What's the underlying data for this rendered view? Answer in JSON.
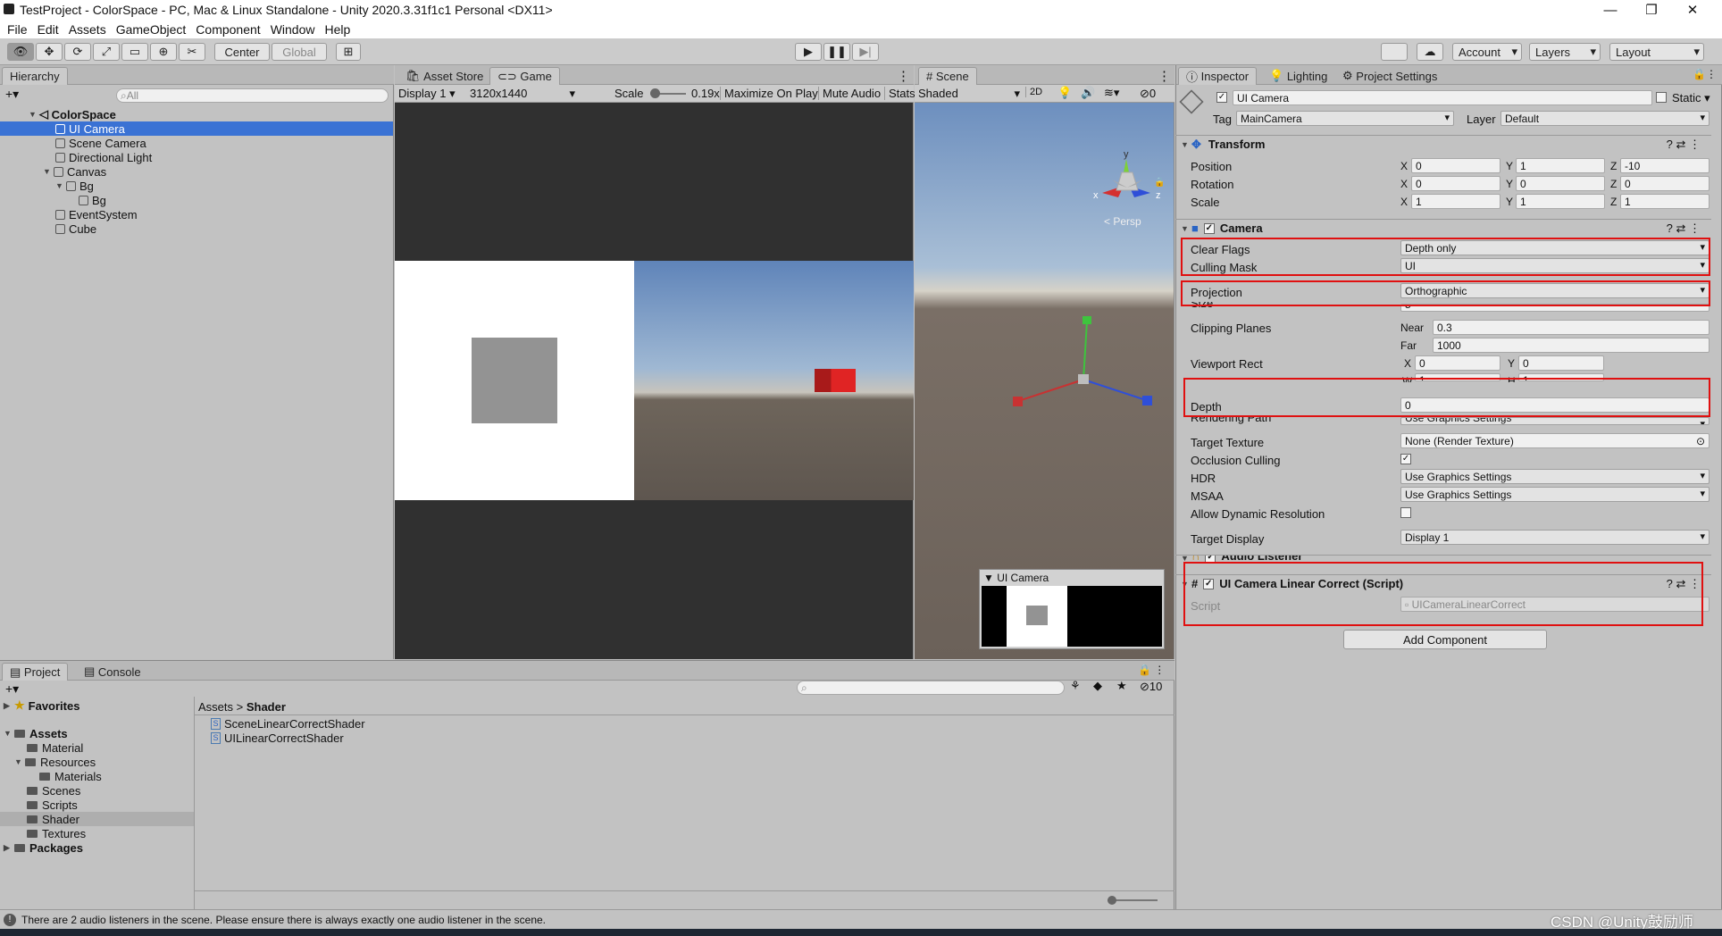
{
  "window": {
    "title": "TestProject - ColorSpace - PC, Mac & Linux Standalone - Unity 2020.3.31f1c1 Personal <DX11>"
  },
  "menu": [
    "File",
    "Edit",
    "Assets",
    "GameObject",
    "Component",
    "Window",
    "Help"
  ],
  "toolbar": {
    "center": "Center",
    "global": "Global",
    "account": "Account",
    "layers": "Layers",
    "layout": "Layout"
  },
  "hierarchy": {
    "tab": "Hierarchy",
    "search_placeholder": "All",
    "items": [
      {
        "label": "ColorSpace"
      },
      {
        "label": "UI Camera"
      },
      {
        "label": "Scene Camera"
      },
      {
        "label": "Directional Light"
      },
      {
        "label": "Canvas"
      },
      {
        "label": "Bg"
      },
      {
        "label": "Bg"
      },
      {
        "label": "EventSystem"
      },
      {
        "label": "Cube"
      }
    ]
  },
  "game": {
    "tabs": [
      "Asset Store",
      "Game"
    ],
    "display": "Display 1",
    "resolution": "3120x1440",
    "scale_label": "Scale",
    "scale_value": "0.19x",
    "maximize": "Maximize On Play",
    "mute": "Mute Audio",
    "stats": "Stats"
  },
  "scene": {
    "tab": "Scene",
    "shading": "Shaded",
    "mode_2d": "2D",
    "gizmo_count": "0",
    "persp": "< Persp",
    "preview_title": "UI Camera",
    "axis_y": "y",
    "axis_x": "x",
    "axis_z": "z"
  },
  "inspector": {
    "tabs": [
      "Inspector",
      "Lighting",
      "Project Settings"
    ],
    "object_name": "UI Camera",
    "static_label": "Static",
    "tag_label": "Tag",
    "tag_value": "MainCamera",
    "layer_label": "Layer",
    "layer_value": "Default",
    "transform": {
      "title": "Transform",
      "position": {
        "label": "Position",
        "x": "0",
        "y": "1",
        "z": "-10"
      },
      "rotation": {
        "label": "Rotation",
        "x": "0",
        "y": "0",
        "z": "0"
      },
      "scale": {
        "label": "Scale",
        "x": "1",
        "y": "1",
        "z": "1"
      }
    },
    "camera": {
      "title": "Camera",
      "clear_flags": {
        "label": "Clear Flags",
        "value": "Depth only"
      },
      "culling_mask": {
        "label": "Culling Mask",
        "value": "UI"
      },
      "projection": {
        "label": "Projection",
        "value": "Orthographic"
      },
      "size": {
        "label": "Size",
        "value": "5"
      },
      "clipping": {
        "label": "Clipping Planes",
        "near_label": "Near",
        "near": "0.3",
        "far_label": "Far",
        "far": "1000"
      },
      "viewport": {
        "label": "Viewport Rect",
        "x": "0",
        "y": "0",
        "w": "1",
        "h": "1"
      },
      "depth": {
        "label": "Depth",
        "value": "0"
      },
      "rendering_path": {
        "label": "Rendering Path",
        "value": "Use Graphics Settings"
      },
      "target_texture": {
        "label": "Target Texture",
        "value": "None (Render Texture)"
      },
      "occlusion": {
        "label": "Occlusion Culling"
      },
      "hdr": {
        "label": "HDR",
        "value": "Use Graphics Settings"
      },
      "msaa": {
        "label": "MSAA",
        "value": "Use Graphics Settings"
      },
      "dynamic_res": {
        "label": "Allow Dynamic Resolution"
      },
      "target_display": {
        "label": "Target Display",
        "value": "Display 1"
      }
    },
    "audio_listener": {
      "title": "Audio Listener"
    },
    "script_comp": {
      "title": "UI Camera Linear Correct (Script)",
      "script_label": "Script",
      "script_value": "UICameraLinearCorrect"
    },
    "add_component": "Add Component"
  },
  "project": {
    "tabs": [
      "Project",
      "Console"
    ],
    "favorites": "Favorites",
    "assets": "Assets",
    "tree": [
      "Material",
      "Resources",
      "Materials",
      "Scenes",
      "Scripts",
      "Shader",
      "Textures"
    ],
    "packages": "Packages",
    "breadcrumb": [
      "Assets",
      "Shader"
    ],
    "files": [
      "SceneLinearCorrectShader",
      "UILinearCorrectShader"
    ],
    "count": "10"
  },
  "status": {
    "message": "There are 2 audio listeners in the scene. Please ensure there is always exactly one audio listener in the scene.",
    "watermark": "CSDN @Unity鼓励师"
  },
  "colors": {
    "accent": "#2d6ac9",
    "highlight": "#e01010",
    "selection": "#3a72d4"
  }
}
